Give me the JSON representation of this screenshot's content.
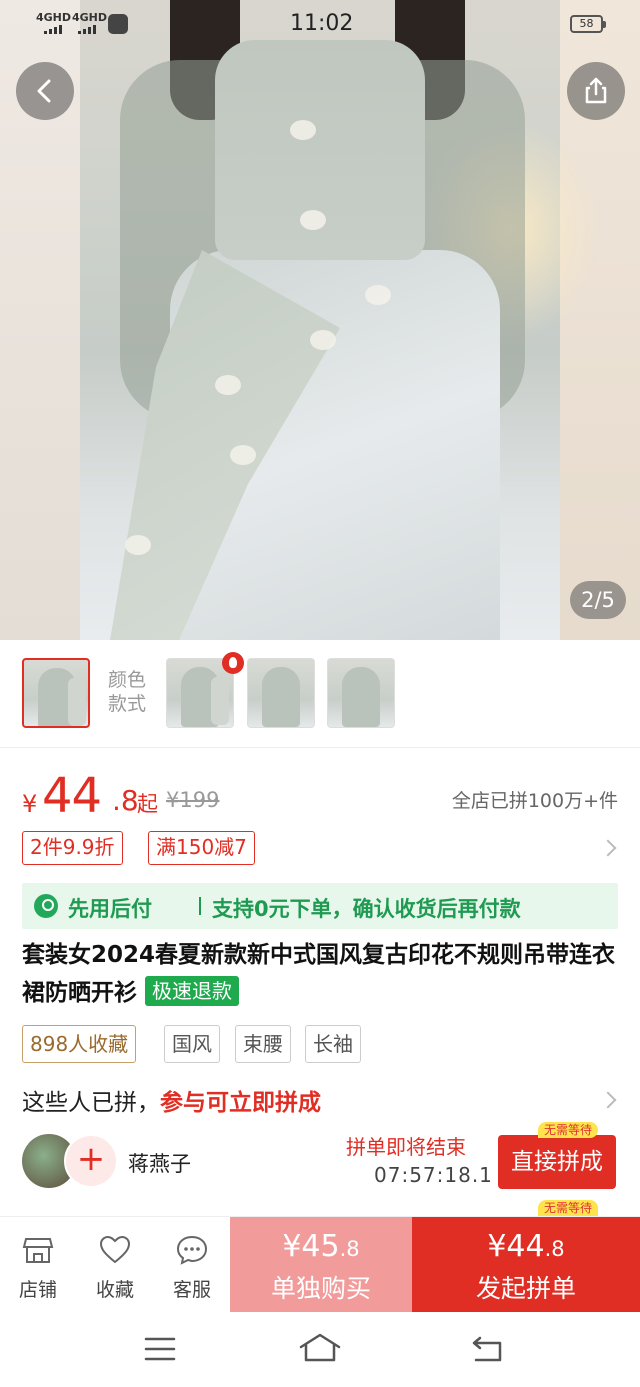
{
  "status_bar": {
    "network1": "4GHD",
    "network2": "4GHD",
    "time": "11:02",
    "battery": "58"
  },
  "hero": {
    "image_counter": "2/5"
  },
  "options": {
    "label_line1": "颜色",
    "label_line2": "款式"
  },
  "price": {
    "currency": "¥",
    "integer": "44",
    "decimal": ".8",
    "suffix": "起",
    "original": "¥199",
    "sold": "全店已拼100万+件"
  },
  "promos": [
    "2件9.9折",
    "满150减7"
  ],
  "pay_later": {
    "label": "先用后付",
    "desc": "支持0元下单，确认收货后再付款"
  },
  "product": {
    "title": "套装女2024春夏新款新中式国风复古印花不规则吊带连衣裙防晒开衫",
    "refund_tag": "极速退款"
  },
  "tags": [
    "898人收藏",
    "国风",
    "束腰",
    "长袖"
  ],
  "group": {
    "header_text": "这些人已拼，",
    "header_highlight": "参与可立即拼成",
    "user_name": "蒋燕子",
    "ending_text": "拼单即将结束",
    "countdown": "07:57:18.1",
    "join_button": "直接拼成",
    "no_wait_badge": "无需等待",
    "no_wait_badge_2": "无需等待"
  },
  "bottom_bar": {
    "store": "店铺",
    "favorite": "收藏",
    "service": "客服",
    "solo_price_int": "¥45",
    "solo_price_dec": ".8",
    "solo_label": "单独购买",
    "group_price_int": "¥44",
    "group_price_dec": ".8",
    "group_label": "发起拼单"
  },
  "colors": {
    "accent": "#e02e24",
    "green": "#1faa4e",
    "solo_bg": "#f29b9b"
  }
}
